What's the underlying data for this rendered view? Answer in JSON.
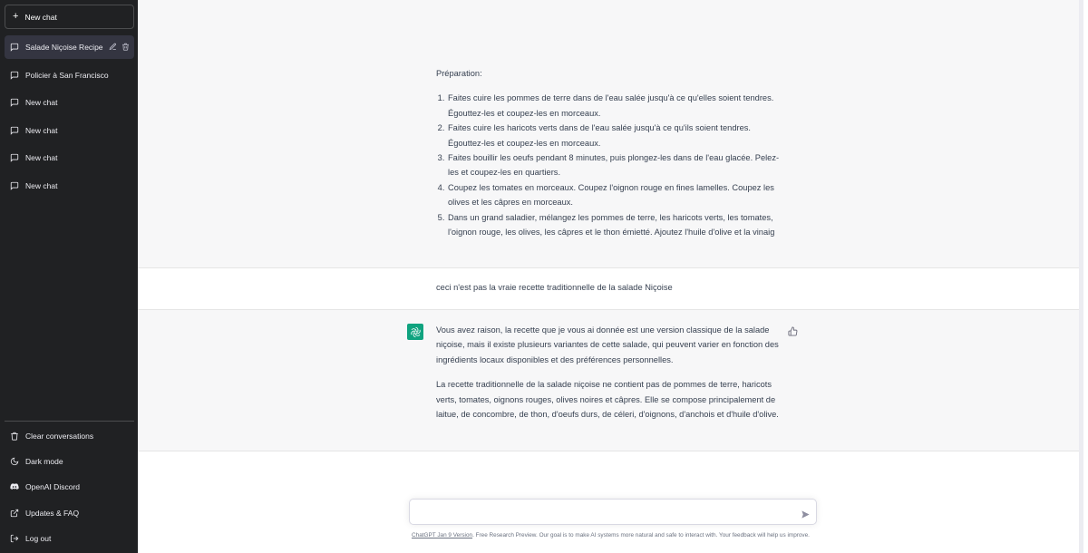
{
  "sidebar": {
    "new_chat_label": "New chat",
    "conversations": [
      {
        "label": "Salade Niçoise Recipe",
        "active": true
      },
      {
        "label": "Policier à San Francisco",
        "active": false
      },
      {
        "label": "New chat",
        "active": false
      },
      {
        "label": "New chat",
        "active": false
      },
      {
        "label": "New chat",
        "active": false
      },
      {
        "label": "New chat",
        "active": false
      }
    ],
    "bottom": {
      "clear": "Clear conversations",
      "dark": "Dark mode",
      "discord": "OpenAI Discord",
      "updates": "Updates & FAQ",
      "logout": "Log out"
    }
  },
  "thread": {
    "bot1": {
      "heading": "Préparation:",
      "steps": [
        "Faites cuire les pommes de terre dans de l'eau salée jusqu'à ce qu'elles soient tendres. Égouttez-les et coupez-les en morceaux.",
        "Faites cuire les haricots verts dans de l'eau salée jusqu'à ce qu'ils soient tendres. Égouttez-les et coupez-les en morceaux.",
        "Faites bouillir les oeufs pendant 8 minutes, puis plongez-les dans de l'eau glacée. Pelez-les et coupez-les en quartiers.",
        "Coupez les tomates en morceaux. Coupez l'oignon rouge en fines lamelles. Coupez les olives et les câpres en morceaux.",
        "Dans un grand saladier, mélangez les pommes de terre, les haricots verts, les tomates, l'oignon rouge, les olives, les câpres et le thon émietté. Ajoutez l'huile d'olive et la vinaig"
      ]
    },
    "user1": "ceci n'est pas la vraie recette traditionnelle de la salade Niçoise",
    "bot2": {
      "p1": "Vous avez raison, la recette que je vous ai donnée est une version classique de la salade niçoise, mais il existe plusieurs variantes de cette salade, qui peuvent varier en fonction des ingrédients locaux disponibles et des préférences personnelles.",
      "p2": "La recette traditionnelle de la salade niçoise ne contient pas de pommes de terre, haricots verts, tomates, oignons rouges, olives noires et câpres. Elle se compose principalement de laitue, de concombre, de thon, d'oeufs durs, de céleri, d'oignons, d'anchois et d'huile d'olive."
    }
  },
  "input": {
    "placeholder": ""
  },
  "footer": {
    "link": "ChatGPT Jan 9 Version",
    "text": ". Free Research Preview. Our goal is to make AI systems more natural and safe to interact with. Your feedback will help us improve."
  },
  "icons": {
    "plus": "plus-icon",
    "chat": "message-icon",
    "edit": "pencil-icon",
    "delete": "trash-icon",
    "clear": "trash-icon",
    "dark": "moon-icon",
    "discord": "discord-icon",
    "updates": "external-link-icon",
    "logout": "logout-icon",
    "assistant": "openai-logo-icon",
    "feedback": "thumbs-up-icon",
    "send": "paper-plane-icon"
  },
  "colors": {
    "sidebar_bg": "#202123",
    "active_item_bg": "#343541",
    "bot_message_bg": "#f7f7f8",
    "assistant_avatar": "#10a37f"
  }
}
